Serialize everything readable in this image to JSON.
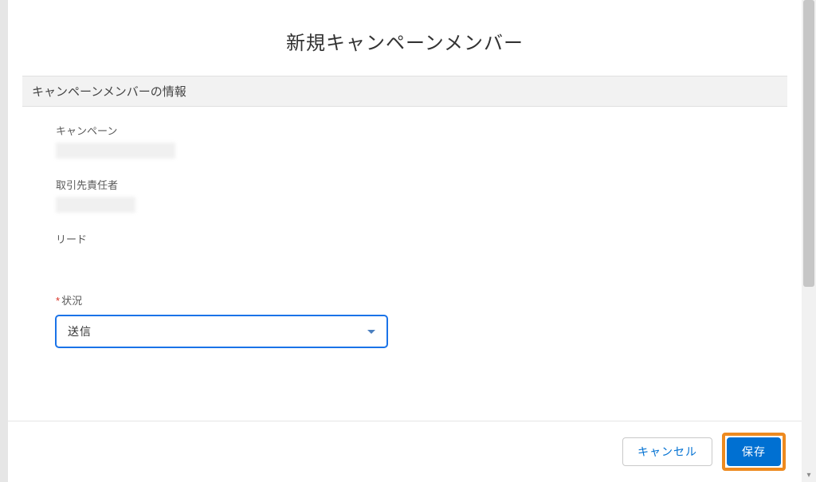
{
  "modal": {
    "title": "新規キャンペーンメンバー"
  },
  "section": {
    "header": "キャンペーンメンバーの情報"
  },
  "fields": {
    "campaign_label": "キャンペーン",
    "contact_label": "取引先責任者",
    "lead_label": "リード",
    "status_label": "状況",
    "status_value": "送信"
  },
  "buttons": {
    "cancel": "キャンセル",
    "save": "保存"
  }
}
